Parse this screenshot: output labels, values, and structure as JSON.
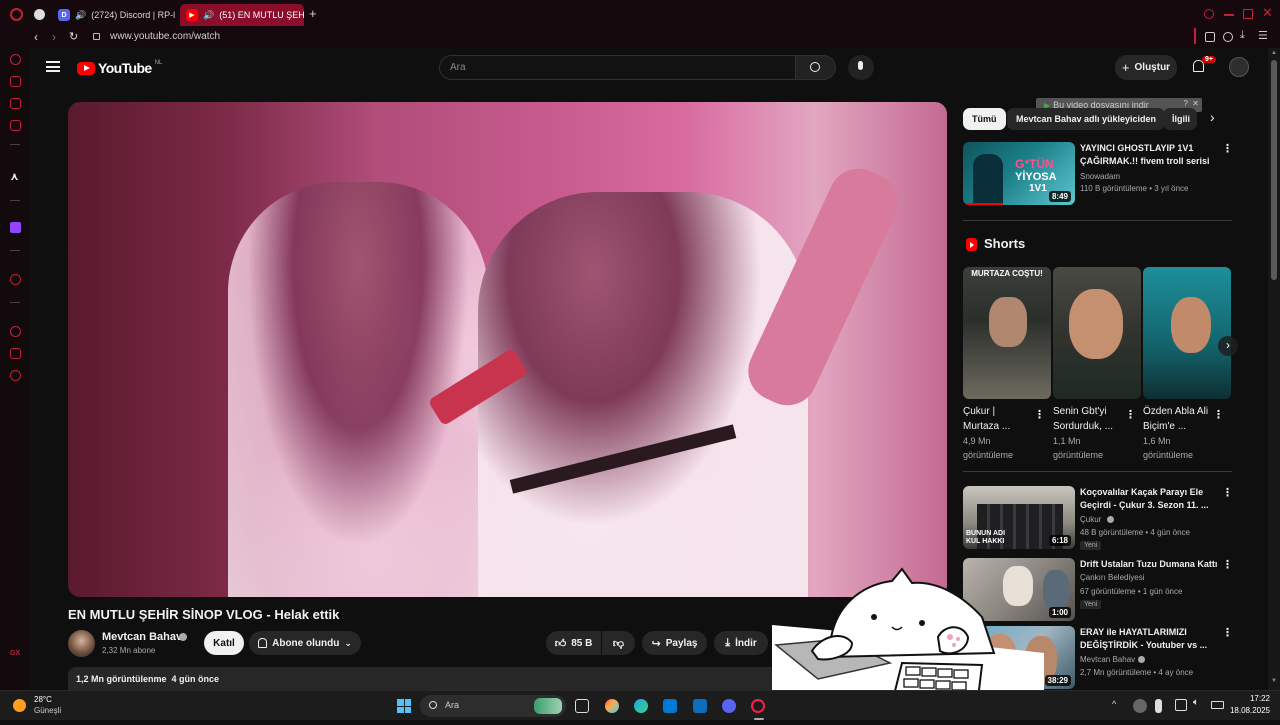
{
  "browser": {
    "tabs": [
      {
        "label": "(2724) Discord | RP-l"
      },
      {
        "label": "(51) EN MUTLU ŞEHİR"
      }
    ],
    "url": "www.youtube.com/watch"
  },
  "yt": {
    "logo_text": "YouTube",
    "logo_region": "NL",
    "search_placeholder": "Ara",
    "create_label": "Oluştur",
    "notif_badge": "9+",
    "video_title": "EN MUTLU ŞEHİR SİNOP VLOG - Helak ettik",
    "channel_name": "Mevtcan Bahav",
    "channel_subs": "2,32 Mn abone",
    "join_label": "Katıl",
    "subscribed_label": "Abone olundu",
    "like_count": "85 B",
    "share_label": "Paylaş",
    "download_label": "İndir",
    "desc_stats": "1,2 Mn görüntülenme  4 gün önce",
    "download_popup": "Bu video dosyasını indir",
    "chips": [
      "Tümü",
      "Mevtcan Bahav adlı yükleyiciden",
      "İlgili"
    ],
    "top_video": {
      "title": "YAYINCI GHOSTLAYIP 1V1 ÇAĞIRMAK.!! fivem troll serisi",
      "channel": "Snowadam",
      "meta": "110 B görüntüleme • 3 yıl önce",
      "duration": "8:49",
      "thumb_text1": "G*TÜN",
      "thumb_text2": "YİYOSA",
      "thumb_text3": "1V1"
    },
    "shorts_heading": "Shorts",
    "shorts": [
      {
        "title": "Çukur | Murtaza ...",
        "views": "4,9 Mn",
        "views_label": "görüntüleme",
        "overlay": "MURTAZA COŞTU!"
      },
      {
        "title": "Senin Gbt'yi Sordurduk, ...",
        "views": "1,1 Mn",
        "views_label": "görüntüleme",
        "overlay": ""
      },
      {
        "title": "Özden Abla Ali Biçim'e ...",
        "views": "1,6 Mn",
        "views_label": "görüntüleme",
        "overlay": ""
      }
    ],
    "videos": [
      {
        "title": "Koçovalılar Kaçak Parayı Ele Geçirdi - Çukur 3. Sezon 11. ...",
        "channel": "Çukur",
        "meta": "48 B görüntüleme • 4 gün önce",
        "badge": "Yeni",
        "duration": "6:18",
        "thumb_text": "BUNUN ADI KUL HAKKI"
      },
      {
        "title": "Drift Ustaları Tuzu Dumana Kattı",
        "channel": "Çankırı Belediyesi",
        "meta": "67 görüntüleme • 1 gün önce",
        "badge": "Yeni",
        "duration": "1:00",
        "thumb_text": ""
      },
      {
        "title": "ERAY ile HAYATLARIMIZI DEĞİŞTİRDİK - Youtuber vs ...",
        "channel": "Mevtcan Bahav",
        "meta": "2,7 Mn görüntüleme • 4 ay önce",
        "badge": "",
        "duration": "38:29",
        "thumb_text": ""
      }
    ]
  },
  "taskbar": {
    "weather_temp": "28°C",
    "weather_desc": "Güneşli",
    "search_placeholder": "Ara",
    "time": "17:22",
    "date": "18.08.2025"
  },
  "colors": {
    "browser_accent": "#c2213d",
    "yt_red": "#ff0000",
    "bg": "#0f0f0f"
  }
}
